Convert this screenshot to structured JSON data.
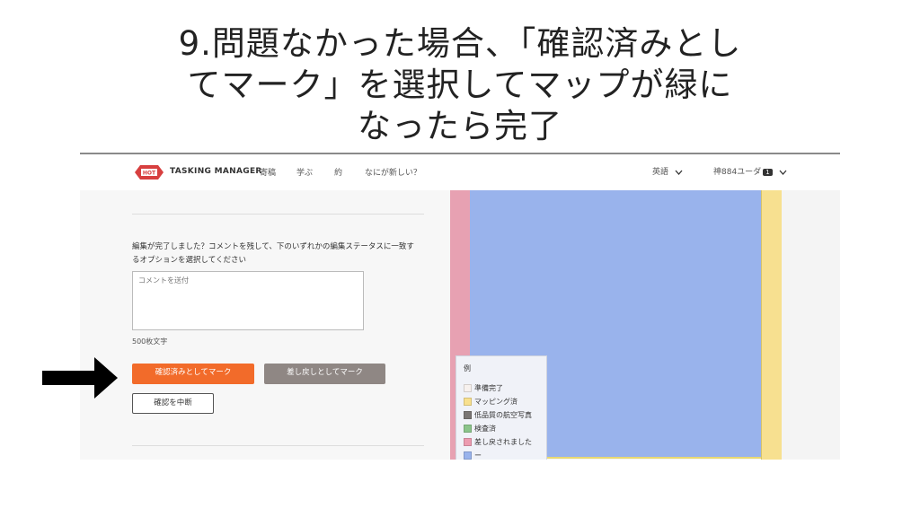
{
  "slide": {
    "title_line1": "9.問題なかった場合、「確認済みとし",
    "title_line2": "てマーク」を選択してマップが緑に",
    "title_line3": "なったら完了"
  },
  "navbar": {
    "brand": "TASKING MANAGER",
    "logo_text": "HOT",
    "links": [
      "寄稿",
      "学ぶ",
      "約",
      "なにが新しい？"
    ],
    "language": "英語",
    "user_name": "神884ユーダ",
    "user_badge": "1"
  },
  "panel": {
    "prompt": "編集が完了しました？コメントを残して、下のいずれかの編集ステータスに一致するオプションを選択してください",
    "comment_placeholder": "コメントを送付",
    "char_limit": "500枚文字",
    "btn_validated": "確認済みとしてマーク",
    "btn_invalidated": "差し戻しとしてマーク",
    "btn_stop": "確認を中断"
  },
  "legend": {
    "title": "例",
    "items": [
      {
        "label": "準備完了",
        "color": "#f7f1ee"
      },
      {
        "label": "マッピング済",
        "color": "#f8e08e"
      },
      {
        "label": "低品質の航空写真",
        "color": "#7a7674"
      },
      {
        "label": "検査済",
        "color": "#8bc48a"
      },
      {
        "label": "差し戻されました",
        "color": "#ec9bb0"
      },
      {
        "label": "ー",
        "color": "#99b3ec"
      }
    ]
  },
  "colors": {
    "accent": "#f26b2a",
    "secondary_button": "#8f8784",
    "map_blue": "#99b3ec"
  },
  "icons": [
    "hot-logo-icon",
    "chevron-down-icon",
    "arrow-right-icon"
  ]
}
